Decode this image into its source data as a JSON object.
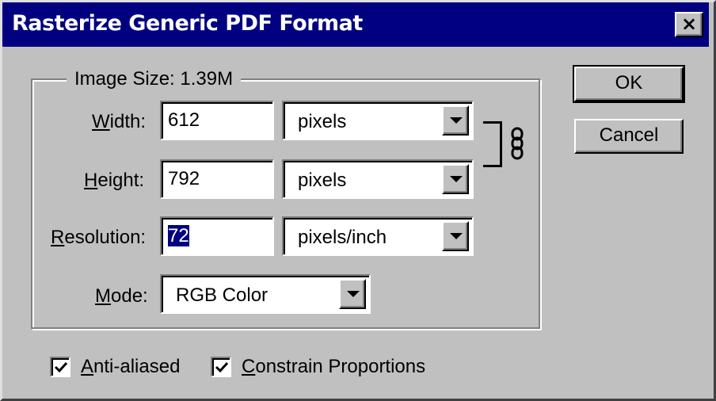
{
  "dialog": {
    "title": "Rasterize Generic PDF Format",
    "close_label": "×"
  },
  "image_size": {
    "legend": "Image Size: 1.39M",
    "width": {
      "label_mnemonic": "W",
      "label_rest": "idth:",
      "value": "612",
      "unit": "pixels"
    },
    "height": {
      "label_mnemonic": "H",
      "label_rest": "eight:",
      "value": "792",
      "unit": "pixels"
    },
    "resolution": {
      "label_mnemonic": "R",
      "label_rest": "esolution:",
      "value": "72",
      "unit": "pixels/inch",
      "value_selected": true
    },
    "mode": {
      "label_mnemonic": "M",
      "label_rest": "ode:",
      "value": "RGB Color"
    },
    "constrain_link_icon": "chain-link-icon"
  },
  "buttons": {
    "ok": "OK",
    "cancel": "Cancel"
  },
  "options": {
    "anti_aliased": {
      "mnemonic": "A",
      "rest": "nti-aliased",
      "checked": true
    },
    "constrain_proportions": {
      "mnemonic": "C",
      "rest": "onstrain Proportions",
      "checked": true
    }
  }
}
